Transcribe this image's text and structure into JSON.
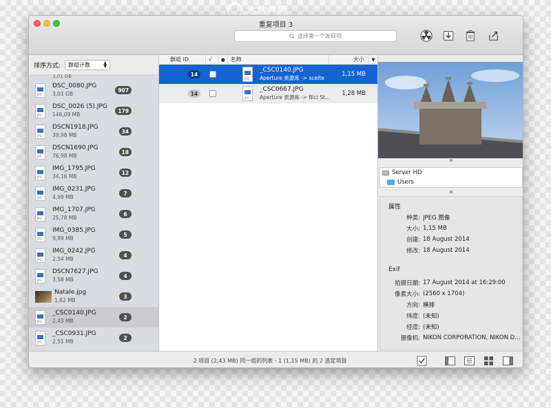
{
  "watermark": "本软件园",
  "window": {
    "title": "重复项目 3"
  },
  "toolbar": {
    "search_placeholder": "选择第一个发现项",
    "buttons": [
      {
        "name": "nuke-button",
        "icon": "radiation-icon"
      },
      {
        "name": "move-button",
        "icon": "tray-down-icon"
      },
      {
        "name": "trash-button",
        "icon": "trash-icon"
      },
      {
        "name": "share-button",
        "icon": "share-icon"
      }
    ]
  },
  "sort": {
    "label": "排序方式:",
    "value": "群组计数"
  },
  "sidebar": {
    "partial_top": "3,01 GB",
    "items": [
      {
        "name": "DSC_0080.JPG",
        "size": "3,01 GB",
        "count": "907"
      },
      {
        "name": "DSC_0026 (5).JPG",
        "size": "146,09 MB",
        "count": "179"
      },
      {
        "name": "DSCN1918.JPG",
        "size": "39,98 MB",
        "count": "34"
      },
      {
        "name": "DSCN1690.JPG",
        "size": "76,98 MB",
        "count": "18"
      },
      {
        "name": "IMG_1795.JPG",
        "size": "34,16 MB",
        "count": "12"
      },
      {
        "name": "IMG_0231.JPG",
        "size": "4,99 MB",
        "count": "7"
      },
      {
        "name": "IMG_1707.JPG",
        "size": "25,78 MB",
        "count": "6"
      },
      {
        "name": "IMG_0385.JPG",
        "size": "9,99 MB",
        "count": "5"
      },
      {
        "name": "IMG_0242.JPG",
        "size": "2,54 MB",
        "count": "4"
      },
      {
        "name": "DSCN7627.JPG",
        "size": "3,58 MB",
        "count": "4"
      },
      {
        "name": "Natale.jpg",
        "size": "1,62 MB",
        "count": "3",
        "photo": true
      },
      {
        "name": "_CSC0140.JPG",
        "size": "2,43 MB",
        "count": "2",
        "selected": true
      },
      {
        "name": "_CSC0931.JPG",
        "size": "2,51 MB",
        "count": "2"
      }
    ]
  },
  "table": {
    "headers": {
      "group": "群组 ID",
      "check": "√",
      "dot": "●",
      "name": "名称",
      "size": "大小"
    },
    "rows": [
      {
        "group": "14",
        "name": "_CSC0140.JPG",
        "path": "Aperture 资源库 -> scelte",
        "size": "1,15 MB",
        "selected": true
      },
      {
        "group": "14",
        "name": "_CSC0667.JPG",
        "path": "Aperture 资源库 -> Bici St...",
        "size": "1,28 MB",
        "selected": false
      }
    ]
  },
  "location": {
    "volume": "Server HD",
    "folder": "Users"
  },
  "properties": {
    "title": "属性",
    "rows": [
      {
        "k": "种类:",
        "v": "JPEG 图像"
      },
      {
        "k": "大小:",
        "v": "1,15 MB"
      },
      {
        "k": "创建:",
        "v": "18 August 2014"
      },
      {
        "k": "修改:",
        "v": "18 August 2014"
      }
    ]
  },
  "exif": {
    "title": "Exif",
    "rows": [
      {
        "k": "拍摄日期:",
        "v": "17 August 2014 at 16:29:00"
      },
      {
        "k": "像素大小:",
        "v": "(2560 x 1704)"
      },
      {
        "k": "方向:",
        "v": "横排"
      },
      {
        "k": "纬度:",
        "v": "(未知)"
      },
      {
        "k": "经度:",
        "v": "(未知)"
      },
      {
        "k": "摄像机:",
        "v": "NIKON CORPORATION, NIKON D..."
      }
    ]
  },
  "status": {
    "text": "2 项目 (2,43 MB) 同一组的列表 - 1 (1,15 MB) 的 2 选定项目"
  },
  "colors": {
    "selection": "#1463d1",
    "badge": "#4f4f4f",
    "sidebar_bg": "#d8dde4"
  }
}
